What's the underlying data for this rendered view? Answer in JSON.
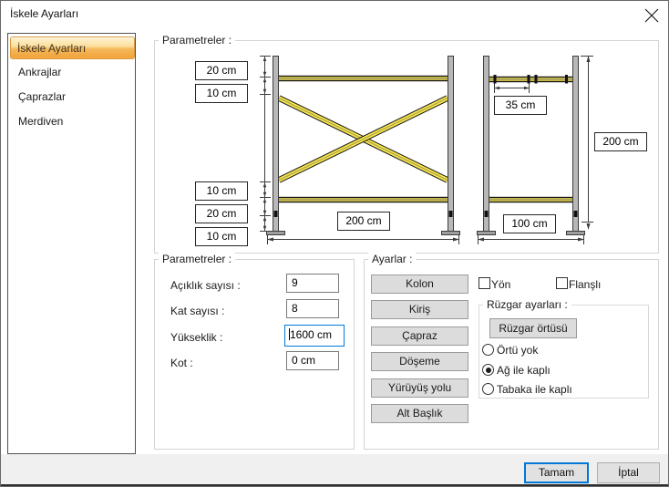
{
  "dialog": {
    "title": "İskele Ayarları"
  },
  "sidebar": {
    "items": [
      {
        "label": "İskele Ayarları",
        "selected": true
      },
      {
        "label": "Ankrajlar",
        "selected": false
      },
      {
        "label": "Çaprazlar",
        "selected": false
      },
      {
        "label": "Merdiven",
        "selected": false
      }
    ]
  },
  "diagram_group": {
    "label": "Parametreler :",
    "dims": {
      "top1": "20 cm",
      "top2": "10 cm",
      "bottom1": "10 cm",
      "bottom2": "20 cm",
      "bottom3": "10 cm",
      "front_width": "200 cm",
      "side_offset": "35 cm",
      "side_height": "200 cm",
      "side_width": "100 cm"
    },
    "colors": {
      "rail_yellow": "#f5e34a",
      "post_gray": "#b8b8b8"
    }
  },
  "params_group": {
    "label": "Parametreler :",
    "fields": [
      {
        "label": "Açıklık sayısı :",
        "value": "9",
        "focused": false
      },
      {
        "label": "Kat sayısı :",
        "value": "8",
        "focused": false
      },
      {
        "label": "Yükseklik :",
        "value": "1600 cm",
        "focused": true
      },
      {
        "label": "Kot :",
        "value": "0 cm",
        "focused": false
      }
    ]
  },
  "settings_group": {
    "label": "Ayarlar :",
    "buttons": [
      "Kolon",
      "Kiriş",
      "Çapraz",
      "Döşeme",
      "Yürüyüş yolu",
      "Alt Başlık"
    ],
    "checkboxes": [
      {
        "label": "Yön",
        "checked": false
      },
      {
        "label": "Flanşlı",
        "checked": false
      }
    ],
    "wind_group": {
      "label": "Rüzgar ayarları :",
      "button": "Rüzgar örtüsü",
      "radios": [
        {
          "label": "Örtü yok",
          "checked": false
        },
        {
          "label": "Ağ ile kaplı",
          "checked": true
        },
        {
          "label": "Tabaka ile kaplı",
          "checked": false
        }
      ]
    }
  },
  "footer": {
    "ok": "Tamam",
    "cancel": "İptal"
  },
  "colors": {
    "accent": "#0078d7",
    "selection_orange": "#f6ba5e",
    "footer_gray": "#f0f0f0"
  }
}
